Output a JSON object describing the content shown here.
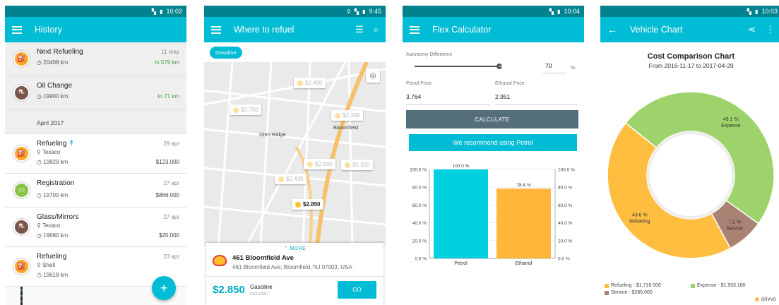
{
  "screen1": {
    "status_time": "10:02",
    "title": "History",
    "rows": [
      {
        "title": "Next Refueling",
        "sub": "20408 km",
        "date": "11 may",
        "value": "In 579 km"
      },
      {
        "title": "Oil Change",
        "sub": "19900 km",
        "date": "",
        "value": "In 71 km"
      }
    ],
    "month": "April 2017",
    "entries": [
      {
        "title": "Refueling",
        "place": "Texaco",
        "km": "19829 km",
        "date": "29 apr",
        "value": "$123.000"
      },
      {
        "title": "Registration",
        "km": "19700 km",
        "date": "27 apr",
        "value": "$866.000"
      },
      {
        "title": "Glass/Mirrors",
        "place": "Texaco",
        "km": "19680 km",
        "date": "27 apr",
        "value": "$20.000"
      },
      {
        "title": "Refueling",
        "place": "Shell",
        "km": "19618 km",
        "date": "23 apr",
        "value": "$...00"
      }
    ],
    "fab": "+"
  },
  "screen2": {
    "status_time": "9:45",
    "title": "Where to refuel",
    "chip": "Gasoline",
    "prices": [
      "$2.490",
      "$2.750",
      "$2.399",
      "$2.550",
      "$2.350",
      "$2.439",
      "$2.850"
    ],
    "labels": {
      "glen": "Glen Ridge",
      "bloom": "Bloomfield"
    },
    "card": {
      "more": "MORE",
      "name": "461 Bloomfield Ave",
      "address": "461 Bloomfield Ave, Bloomfield, NJ 07003, USA",
      "price": "$2.850",
      "fuel": "Gasoline",
      "date": "02/11/2017",
      "go": "GO"
    }
  },
  "screen3": {
    "status_time": "10:04",
    "title": "Flex Calculator",
    "autonomy_label": "Autonomy Difference",
    "autonomy_value": "70",
    "autonomy_unit": "%",
    "petrol_label": "Petrol Price",
    "petrol_value": "3.764",
    "ethanol_label": "Ethanol Price",
    "ethanol_value": "2.951",
    "calculate": "CALCULATE",
    "recommend": "We recommend using Petrol"
  },
  "screen4": {
    "status_time": "10:03",
    "title": "Vehicle Chart",
    "chart_title": "Cost Comparison Chart",
    "chart_subtitle": "From 2016-11-17 to 2017-04-29",
    "legend": [
      "Refueling - $1,716.000",
      "Expense - $1,933.160",
      "Service - $285.000"
    ],
    "brand": "drivvo"
  },
  "chart_data": [
    {
      "type": "bar",
      "categories": [
        "Petrol",
        "Ethanol"
      ],
      "values": [
        100.0,
        78.4
      ],
      "data_labels": [
        "100.0 %",
        "78.4 %"
      ],
      "ylim": [
        0,
        100
      ],
      "yticks": [
        "0.0 %",
        "20.0 %",
        "40.0 %",
        "60.0 %",
        "80.0 %",
        "100.0 %"
      ],
      "colors": [
        "#00d0e0",
        "#ffb63b"
      ]
    },
    {
      "type": "pie",
      "categories": [
        "Expense",
        "Service",
        "Refueling"
      ],
      "values": [
        49.1,
        7.2,
        43.6
      ],
      "slice_labels": [
        "49.1 %",
        "7.2 %",
        "43.6 %"
      ],
      "colors": [
        "#9ed36b",
        "#a98274",
        "#ffbe40"
      ]
    }
  ]
}
